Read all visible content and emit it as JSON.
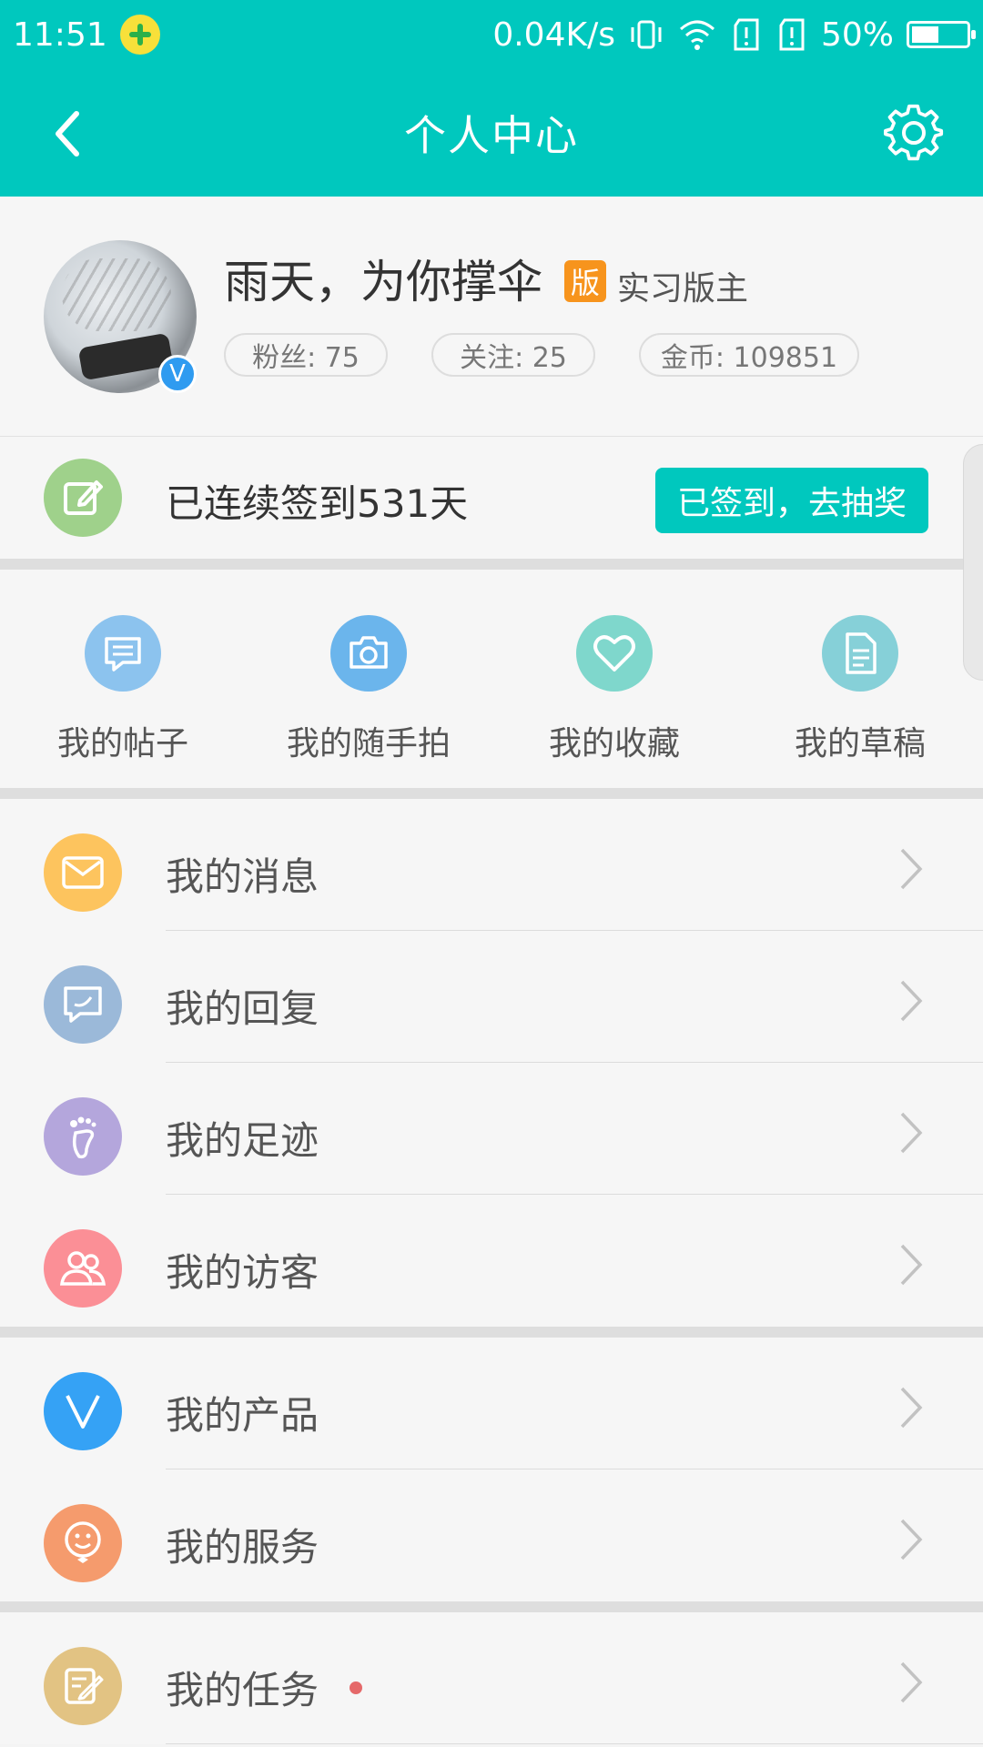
{
  "status_bar": {
    "time": "11:51",
    "network_speed": "0.04K/s",
    "battery_text": "50%",
    "battery_level": 0.5,
    "icons": [
      "app-notification-icon",
      "vibrate-icon",
      "wifi-icon",
      "sim1-icon",
      "sim2-icon",
      "battery-icon"
    ]
  },
  "header": {
    "title": "个人中心",
    "back_icon": "chevron-left-icon",
    "settings_icon": "gear-icon"
  },
  "profile": {
    "username": "雨天，为你撑伞",
    "badge": "版",
    "role": "实习版主",
    "verified": "V",
    "stats": {
      "fans": "粉丝: 75",
      "following": "关注: 25",
      "coins": "金币: 109851"
    }
  },
  "checkin": {
    "text": "已连续签到531天",
    "button": "已签到，去抽奖",
    "icon": "edit-note-icon"
  },
  "shortcuts": [
    {
      "label": "我的帖子",
      "icon": "post-icon",
      "color": "#8cc3ee"
    },
    {
      "label": "我的随手拍",
      "icon": "camera-icon",
      "color": "#6bb5ec"
    },
    {
      "label": "我的收藏",
      "icon": "heart-icon",
      "color": "#7fd7cc"
    },
    {
      "label": "我的草稿",
      "icon": "draft-icon",
      "color": "#86d0d8"
    }
  ],
  "menu_group1": [
    {
      "label": "我的消息",
      "icon": "envelope-icon",
      "color": "#fdc45e"
    },
    {
      "label": "我的回复",
      "icon": "reply-icon",
      "color": "#9bb9d9"
    },
    {
      "label": "我的足迹",
      "icon": "footprint-icon",
      "color": "#b4a6dc"
    },
    {
      "label": "我的访客",
      "icon": "visitors-icon",
      "color": "#fb8f96"
    }
  ],
  "menu_group2": [
    {
      "label": "我的产品",
      "icon": "product-v-icon",
      "color": "#35a2f5"
    },
    {
      "label": "我的服务",
      "icon": "smile-icon",
      "color": "#f59b6d"
    }
  ],
  "menu_group3": [
    {
      "label": "我的任务",
      "icon": "task-icon",
      "color": "#e2c383",
      "has_dot": true
    }
  ]
}
